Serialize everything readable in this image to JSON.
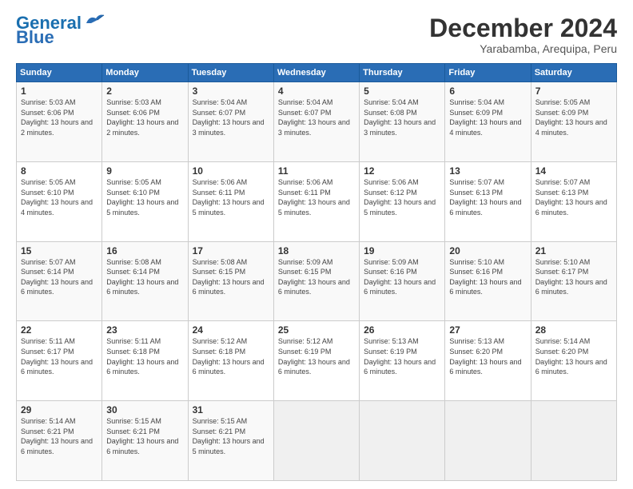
{
  "logo": {
    "line1": "General",
    "line2": "Blue"
  },
  "title": "December 2024",
  "subtitle": "Yarabamba, Arequipa, Peru",
  "days_header": [
    "Sunday",
    "Monday",
    "Tuesday",
    "Wednesday",
    "Thursday",
    "Friday",
    "Saturday"
  ],
  "weeks": [
    [
      {
        "day": "1",
        "sunrise": "5:03 AM",
        "sunset": "6:06 PM",
        "daylight": "13 hours and 2 minutes."
      },
      {
        "day": "2",
        "sunrise": "5:03 AM",
        "sunset": "6:06 PM",
        "daylight": "13 hours and 2 minutes."
      },
      {
        "day": "3",
        "sunrise": "5:04 AM",
        "sunset": "6:07 PM",
        "daylight": "13 hours and 3 minutes."
      },
      {
        "day": "4",
        "sunrise": "5:04 AM",
        "sunset": "6:07 PM",
        "daylight": "13 hours and 3 minutes."
      },
      {
        "day": "5",
        "sunrise": "5:04 AM",
        "sunset": "6:08 PM",
        "daylight": "13 hours and 3 minutes."
      },
      {
        "day": "6",
        "sunrise": "5:04 AM",
        "sunset": "6:09 PM",
        "daylight": "13 hours and 4 minutes."
      },
      {
        "day": "7",
        "sunrise": "5:05 AM",
        "sunset": "6:09 PM",
        "daylight": "13 hours and 4 minutes."
      }
    ],
    [
      {
        "day": "8",
        "sunrise": "5:05 AM",
        "sunset": "6:10 PM",
        "daylight": "13 hours and 4 minutes."
      },
      {
        "day": "9",
        "sunrise": "5:05 AM",
        "sunset": "6:10 PM",
        "daylight": "13 hours and 5 minutes."
      },
      {
        "day": "10",
        "sunrise": "5:06 AM",
        "sunset": "6:11 PM",
        "daylight": "13 hours and 5 minutes."
      },
      {
        "day": "11",
        "sunrise": "5:06 AM",
        "sunset": "6:11 PM",
        "daylight": "13 hours and 5 minutes."
      },
      {
        "day": "12",
        "sunrise": "5:06 AM",
        "sunset": "6:12 PM",
        "daylight": "13 hours and 5 minutes."
      },
      {
        "day": "13",
        "sunrise": "5:07 AM",
        "sunset": "6:13 PM",
        "daylight": "13 hours and 6 minutes."
      },
      {
        "day": "14",
        "sunrise": "5:07 AM",
        "sunset": "6:13 PM",
        "daylight": "13 hours and 6 minutes."
      }
    ],
    [
      {
        "day": "15",
        "sunrise": "5:07 AM",
        "sunset": "6:14 PM",
        "daylight": "13 hours and 6 minutes."
      },
      {
        "day": "16",
        "sunrise": "5:08 AM",
        "sunset": "6:14 PM",
        "daylight": "13 hours and 6 minutes."
      },
      {
        "day": "17",
        "sunrise": "5:08 AM",
        "sunset": "6:15 PM",
        "daylight": "13 hours and 6 minutes."
      },
      {
        "day": "18",
        "sunrise": "5:09 AM",
        "sunset": "6:15 PM",
        "daylight": "13 hours and 6 minutes."
      },
      {
        "day": "19",
        "sunrise": "5:09 AM",
        "sunset": "6:16 PM",
        "daylight": "13 hours and 6 minutes."
      },
      {
        "day": "20",
        "sunrise": "5:10 AM",
        "sunset": "6:16 PM",
        "daylight": "13 hours and 6 minutes."
      },
      {
        "day": "21",
        "sunrise": "5:10 AM",
        "sunset": "6:17 PM",
        "daylight": "13 hours and 6 minutes."
      }
    ],
    [
      {
        "day": "22",
        "sunrise": "5:11 AM",
        "sunset": "6:17 PM",
        "daylight": "13 hours and 6 minutes."
      },
      {
        "day": "23",
        "sunrise": "5:11 AM",
        "sunset": "6:18 PM",
        "daylight": "13 hours and 6 minutes."
      },
      {
        "day": "24",
        "sunrise": "5:12 AM",
        "sunset": "6:18 PM",
        "daylight": "13 hours and 6 minutes."
      },
      {
        "day": "25",
        "sunrise": "5:12 AM",
        "sunset": "6:19 PM",
        "daylight": "13 hours and 6 minutes."
      },
      {
        "day": "26",
        "sunrise": "5:13 AM",
        "sunset": "6:19 PM",
        "daylight": "13 hours and 6 minutes."
      },
      {
        "day": "27",
        "sunrise": "5:13 AM",
        "sunset": "6:20 PM",
        "daylight": "13 hours and 6 minutes."
      },
      {
        "day": "28",
        "sunrise": "5:14 AM",
        "sunset": "6:20 PM",
        "daylight": "13 hours and 6 minutes."
      }
    ],
    [
      {
        "day": "29",
        "sunrise": "5:14 AM",
        "sunset": "6:21 PM",
        "daylight": "13 hours and 6 minutes."
      },
      {
        "day": "30",
        "sunrise": "5:15 AM",
        "sunset": "6:21 PM",
        "daylight": "13 hours and 6 minutes."
      },
      {
        "day": "31",
        "sunrise": "5:15 AM",
        "sunset": "6:21 PM",
        "daylight": "13 hours and 5 minutes."
      },
      null,
      null,
      null,
      null
    ]
  ]
}
